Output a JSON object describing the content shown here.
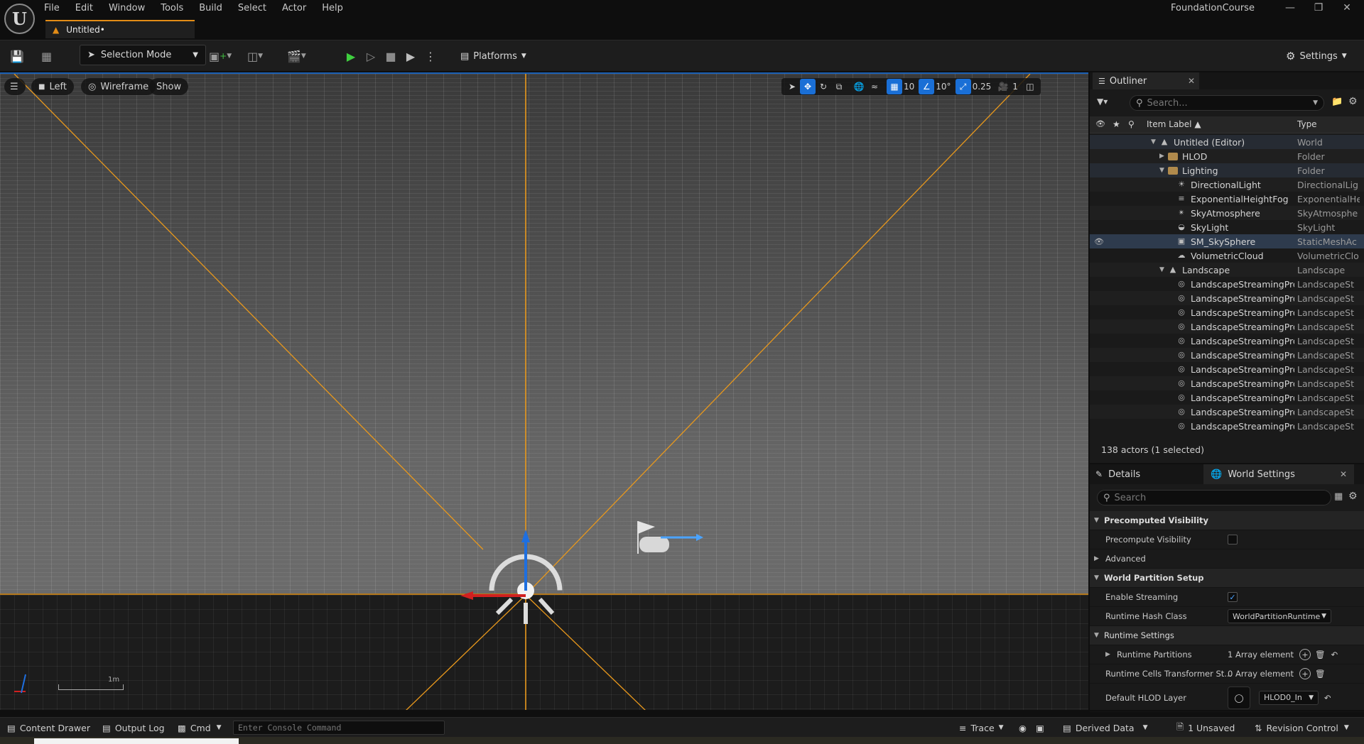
{
  "menu": [
    "File",
    "Edit",
    "Window",
    "Tools",
    "Build",
    "Select",
    "Actor",
    "Help"
  ],
  "doc_tab": "Untitled•",
  "project_name": "FoundationCourse",
  "toolbar": {
    "selection_mode": "Selection Mode",
    "platforms": "Platforms",
    "settings": "Settings"
  },
  "viewport": {
    "view": "Left",
    "mode": "Wireframe",
    "show": "Show",
    "grid_snap": "10",
    "rot_snap": "10°",
    "scale_snap": "0.25",
    "camera_speed": "1",
    "scale_label": "1m"
  },
  "outliner": {
    "tab": "Outliner",
    "search_placeholder": "Search...",
    "col_label": "Item Label ▲",
    "col_type": "Type",
    "rows": [
      {
        "label": "Untitled (Editor)",
        "type": "World",
        "indent": 0,
        "exp": "▼",
        "icon": "world",
        "style": "hl"
      },
      {
        "label": "HLOD",
        "type": "Folder",
        "indent": 1,
        "exp": "▶",
        "icon": "folder",
        "style": ""
      },
      {
        "label": "Lighting",
        "type": "Folder",
        "indent": 1,
        "exp": "▼",
        "icon": "folder",
        "style": "hl"
      },
      {
        "label": "DirectionalLight",
        "type": "DirectionalLig",
        "indent": 2,
        "exp": "",
        "icon": "sun",
        "style": ""
      },
      {
        "label": "ExponentialHeightFog",
        "type": "ExponentialHe",
        "indent": 2,
        "exp": "",
        "icon": "fog",
        "style": ""
      },
      {
        "label": "SkyAtmosphere",
        "type": "SkyAtmosphe",
        "indent": 2,
        "exp": "",
        "icon": "atmo",
        "style": ""
      },
      {
        "label": "SkyLight",
        "type": "SkyLight",
        "indent": 2,
        "exp": "",
        "icon": "skylight",
        "style": ""
      },
      {
        "label": "SM_SkySphere",
        "type": "StaticMeshAc",
        "indent": 2,
        "exp": "",
        "icon": "mesh",
        "style": "sel"
      },
      {
        "label": "VolumetricCloud",
        "type": "VolumetricClo",
        "indent": 2,
        "exp": "",
        "icon": "cloud",
        "style": ""
      },
      {
        "label": "Landscape",
        "type": "Landscape",
        "indent": 1,
        "exp": "▼",
        "icon": "landscape",
        "style": ""
      },
      {
        "label": "LandscapeStreamingPro:",
        "type": "LandscapeSt",
        "indent": 2,
        "exp": "",
        "icon": "lsp",
        "style": ""
      },
      {
        "label": "LandscapeStreamingPro:",
        "type": "LandscapeSt",
        "indent": 2,
        "exp": "",
        "icon": "lsp",
        "style": ""
      },
      {
        "label": "LandscapeStreamingPro:",
        "type": "LandscapeSt",
        "indent": 2,
        "exp": "",
        "icon": "lsp",
        "style": ""
      },
      {
        "label": "LandscapeStreamingPro:",
        "type": "LandscapeSt",
        "indent": 2,
        "exp": "",
        "icon": "lsp",
        "style": ""
      },
      {
        "label": "LandscapeStreamingPro:",
        "type": "LandscapeSt",
        "indent": 2,
        "exp": "",
        "icon": "lsp",
        "style": ""
      },
      {
        "label": "LandscapeStreamingPro:",
        "type": "LandscapeSt",
        "indent": 2,
        "exp": "",
        "icon": "lsp",
        "style": ""
      },
      {
        "label": "LandscapeStreamingPro:",
        "type": "LandscapeSt",
        "indent": 2,
        "exp": "",
        "icon": "lsp",
        "style": ""
      },
      {
        "label": "LandscapeStreamingPro:",
        "type": "LandscapeSt",
        "indent": 2,
        "exp": "",
        "icon": "lsp",
        "style": ""
      },
      {
        "label": "LandscapeStreamingPro:",
        "type": "LandscapeSt",
        "indent": 2,
        "exp": "",
        "icon": "lsp",
        "style": ""
      },
      {
        "label": "LandscapeStreamingPro:",
        "type": "LandscapeSt",
        "indent": 2,
        "exp": "",
        "icon": "lsp",
        "style": ""
      },
      {
        "label": "LandscapeStreamingPro:",
        "type": "LandscapeSt",
        "indent": 2,
        "exp": "",
        "icon": "lsp",
        "style": ""
      }
    ],
    "actor_count": "138 actors (1 selected)"
  },
  "details": {
    "tab_details": "Details",
    "tab_world_settings": "World Settings",
    "search_placeholder": "Search",
    "precomputed_visibility": "Precomputed Visibility",
    "precompute_visibility": "Precompute Visibility",
    "advanced": "Advanced",
    "world_partition_setup": "World Partition Setup",
    "enable_streaming": "Enable Streaming",
    "runtime_hash_class": "Runtime Hash Class",
    "runtime_hash_value": "WorldPartitionRuntime",
    "runtime_settings": "Runtime Settings",
    "runtime_partitions": "Runtime Partitions",
    "runtime_partitions_value": "1 Array element",
    "runtime_cells_transformer": "Runtime Cells Transformer St...",
    "runtime_cells_value": "0 Array element",
    "default_hlod_layer": "Default HLOD Layer",
    "default_hlod_value": "HLOD0_In"
  },
  "statusbar": {
    "content_drawer": "Content Drawer",
    "output_log": "Output Log",
    "cmd": "Cmd",
    "console_placeholder": "Enter Console Command",
    "trace": "Trace",
    "derived_data": "Derived Data",
    "unsaved": "1 Unsaved",
    "revision_control": "Revision Control"
  }
}
